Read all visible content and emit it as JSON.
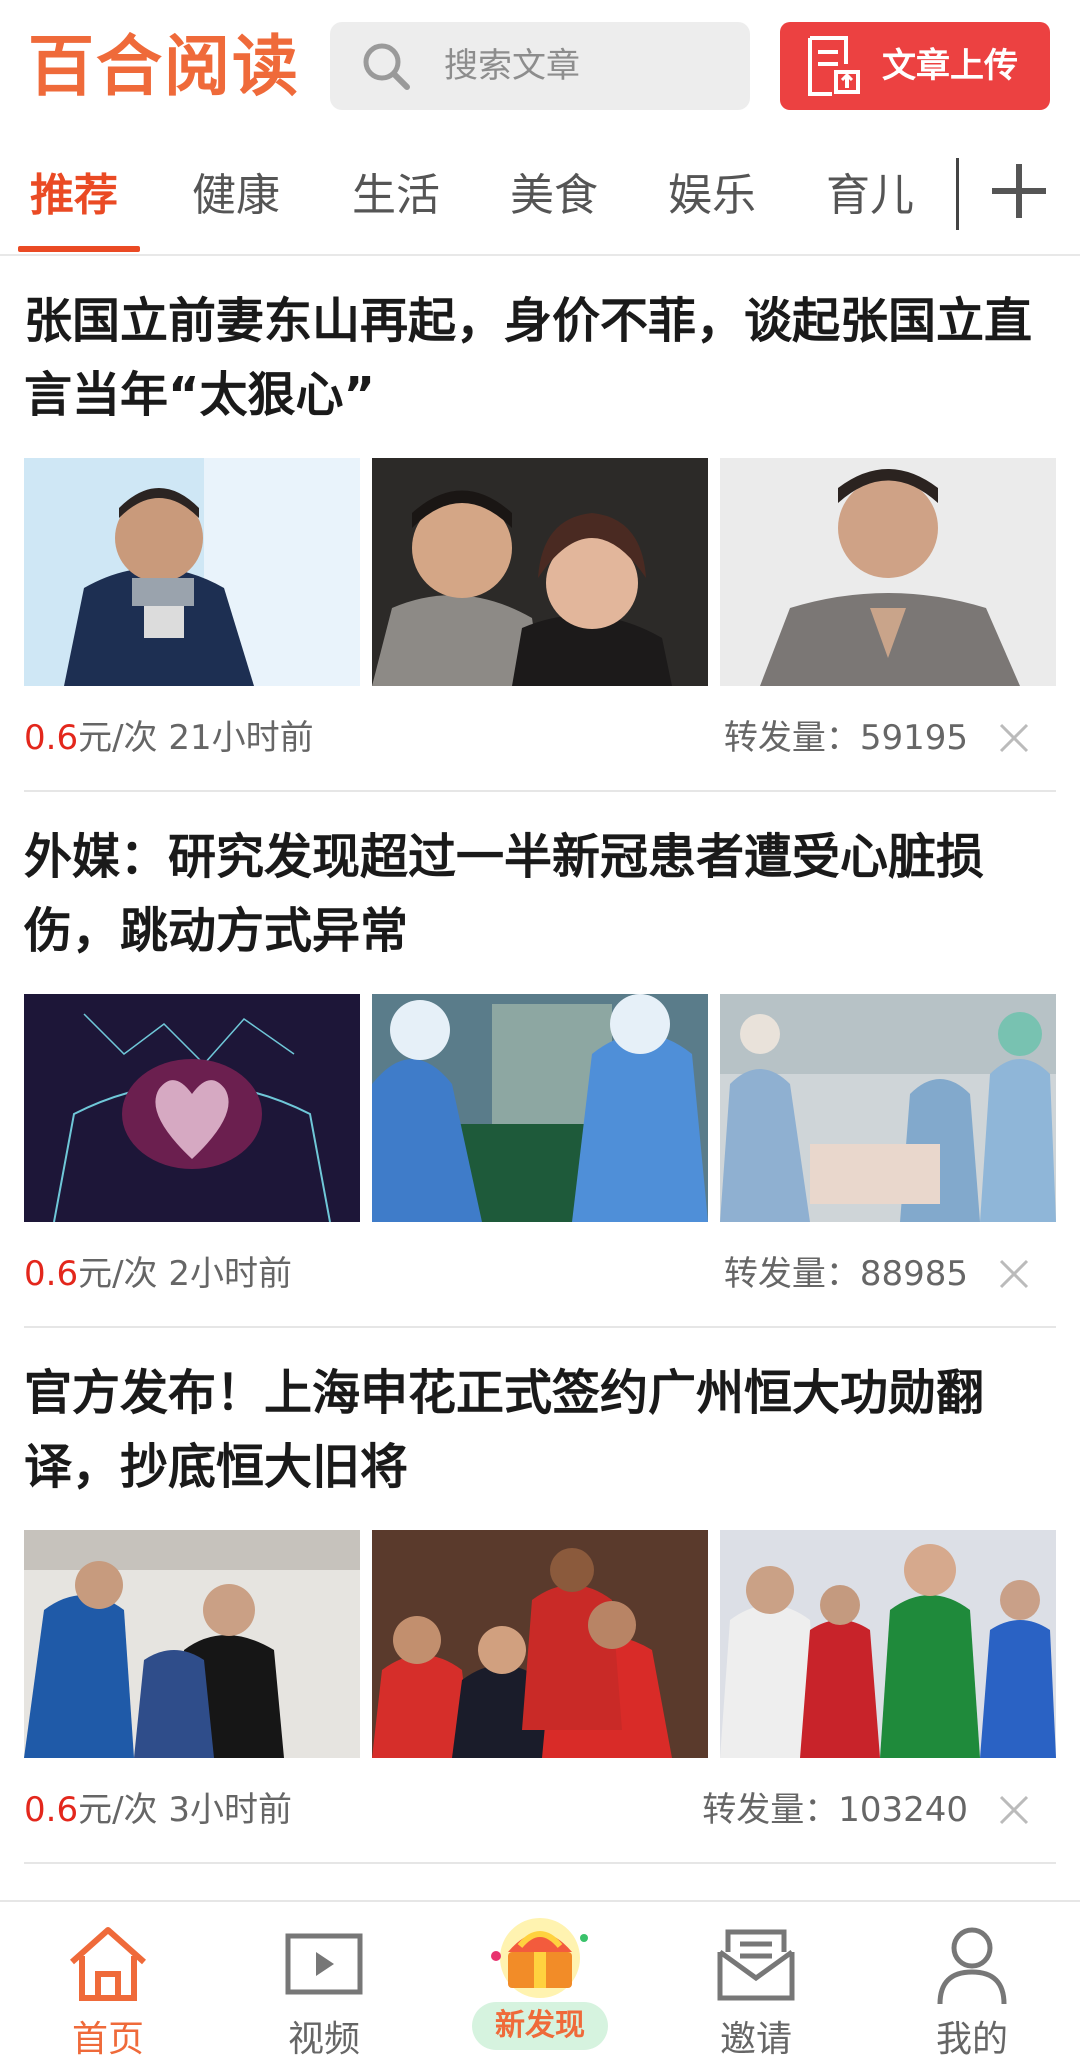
{
  "app": {
    "logo": "百合阅读"
  },
  "search": {
    "placeholder": "搜索文章"
  },
  "upload": {
    "label": "文章上传"
  },
  "tabs": [
    {
      "label": "推荐",
      "active": true
    },
    {
      "label": "健康"
    },
    {
      "label": "生活"
    },
    {
      "label": "美食"
    },
    {
      "label": "娱乐"
    },
    {
      "label": "育儿"
    }
  ],
  "articles": [
    {
      "title": "张国立前妻东山再起，身价不菲，谈起张国立直言当年“太狠心”",
      "price": "0.6",
      "unit": "元/次",
      "time": "21小时前",
      "shares_label": "转发量：",
      "shares": "59195"
    },
    {
      "title": "外媒：研究发现超过一半新冠患者遭受心脏损伤，跳动方式异常",
      "price": "0.6",
      "unit": "元/次",
      "time": "2小时前",
      "shares_label": "转发量：",
      "shares": "88985"
    },
    {
      "title": "官方发布！上海申花正式签约广州恒大功勋翻译，抄底恒大旧将",
      "price": "0.6",
      "unit": "元/次",
      "time": "3小时前",
      "shares_label": "转发量：",
      "shares": "103240"
    }
  ],
  "nav": [
    {
      "label": "首页",
      "icon": "home-icon",
      "active": true
    },
    {
      "label": "视频",
      "icon": "video-icon"
    },
    {
      "label": "新发现",
      "icon": "treasure-chest-icon"
    },
    {
      "label": "邀请",
      "icon": "mail-icon"
    },
    {
      "label": "我的",
      "icon": "user-icon"
    }
  ],
  "colors": {
    "accent": "#ef6a3a",
    "price": "#e3271c",
    "upload_bg": "#ec4141"
  }
}
